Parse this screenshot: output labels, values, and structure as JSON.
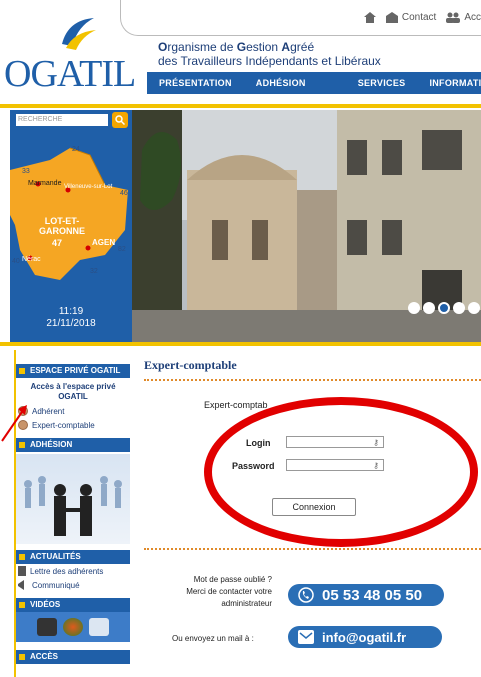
{
  "header": {
    "logo_text": "OGATIL",
    "org_line1_parts": [
      "O",
      "rganisme de ",
      "G",
      "estion ",
      "A",
      "gréé"
    ],
    "org_line1": "Organisme de Gestion Agréé",
    "org_line2": "des Travailleurs Indépendants et Libéraux",
    "top_links": [
      "Contact",
      "Acc"
    ],
    "nav": [
      "PRÉSENTATION",
      "ADHÉSION",
      "SERVICES",
      "INFORMATIONS"
    ]
  },
  "map_panel": {
    "search_placeholder": "RECHERCHE",
    "region": "LOT-ET-GARONNE",
    "department_number": "47",
    "cities": [
      "Marmande",
      "Villeneuve-sur-Lot",
      "AGEN",
      "Nérac"
    ],
    "numbers": [
      "24",
      "33",
      "40",
      "82",
      "32",
      "46"
    ],
    "time": "11:19",
    "date": "21/11/2018"
  },
  "sidebar": {
    "espace_title": "ESPACE PRIVÉ OGATIL",
    "espace_sub": "Accès à l'espace privé OGATIL",
    "options": [
      "Adhérent",
      "Expert-comptable"
    ],
    "adhesion_title": "ADHÉSION",
    "actualites_title": "ACTUALITÉS",
    "actualites_items": [
      "Lettre des adhérents",
      "Communiqué"
    ],
    "videos_title": "VIDÉOS",
    "acces_title": "ACCÈS"
  },
  "main": {
    "title": "Expert-comptable",
    "subtitle": "Expert-comptab",
    "login_label": "Login",
    "password_label": "Password",
    "submit_label": "Connexion",
    "forgot_line1": "Mot de passe oublié ?",
    "forgot_line2": "Merci de contacter votre",
    "forgot_line3": "administrateur",
    "phone": "05 53 48 05 50",
    "email_prompt": "Ou envoyez un mail à :",
    "email": "info@ogatil.fr"
  },
  "colors": {
    "brand_blue": "#1f5fa8",
    "accent_yellow": "#f2c200",
    "map_orange": "#f5a623",
    "annotation_red": "#e10000"
  }
}
